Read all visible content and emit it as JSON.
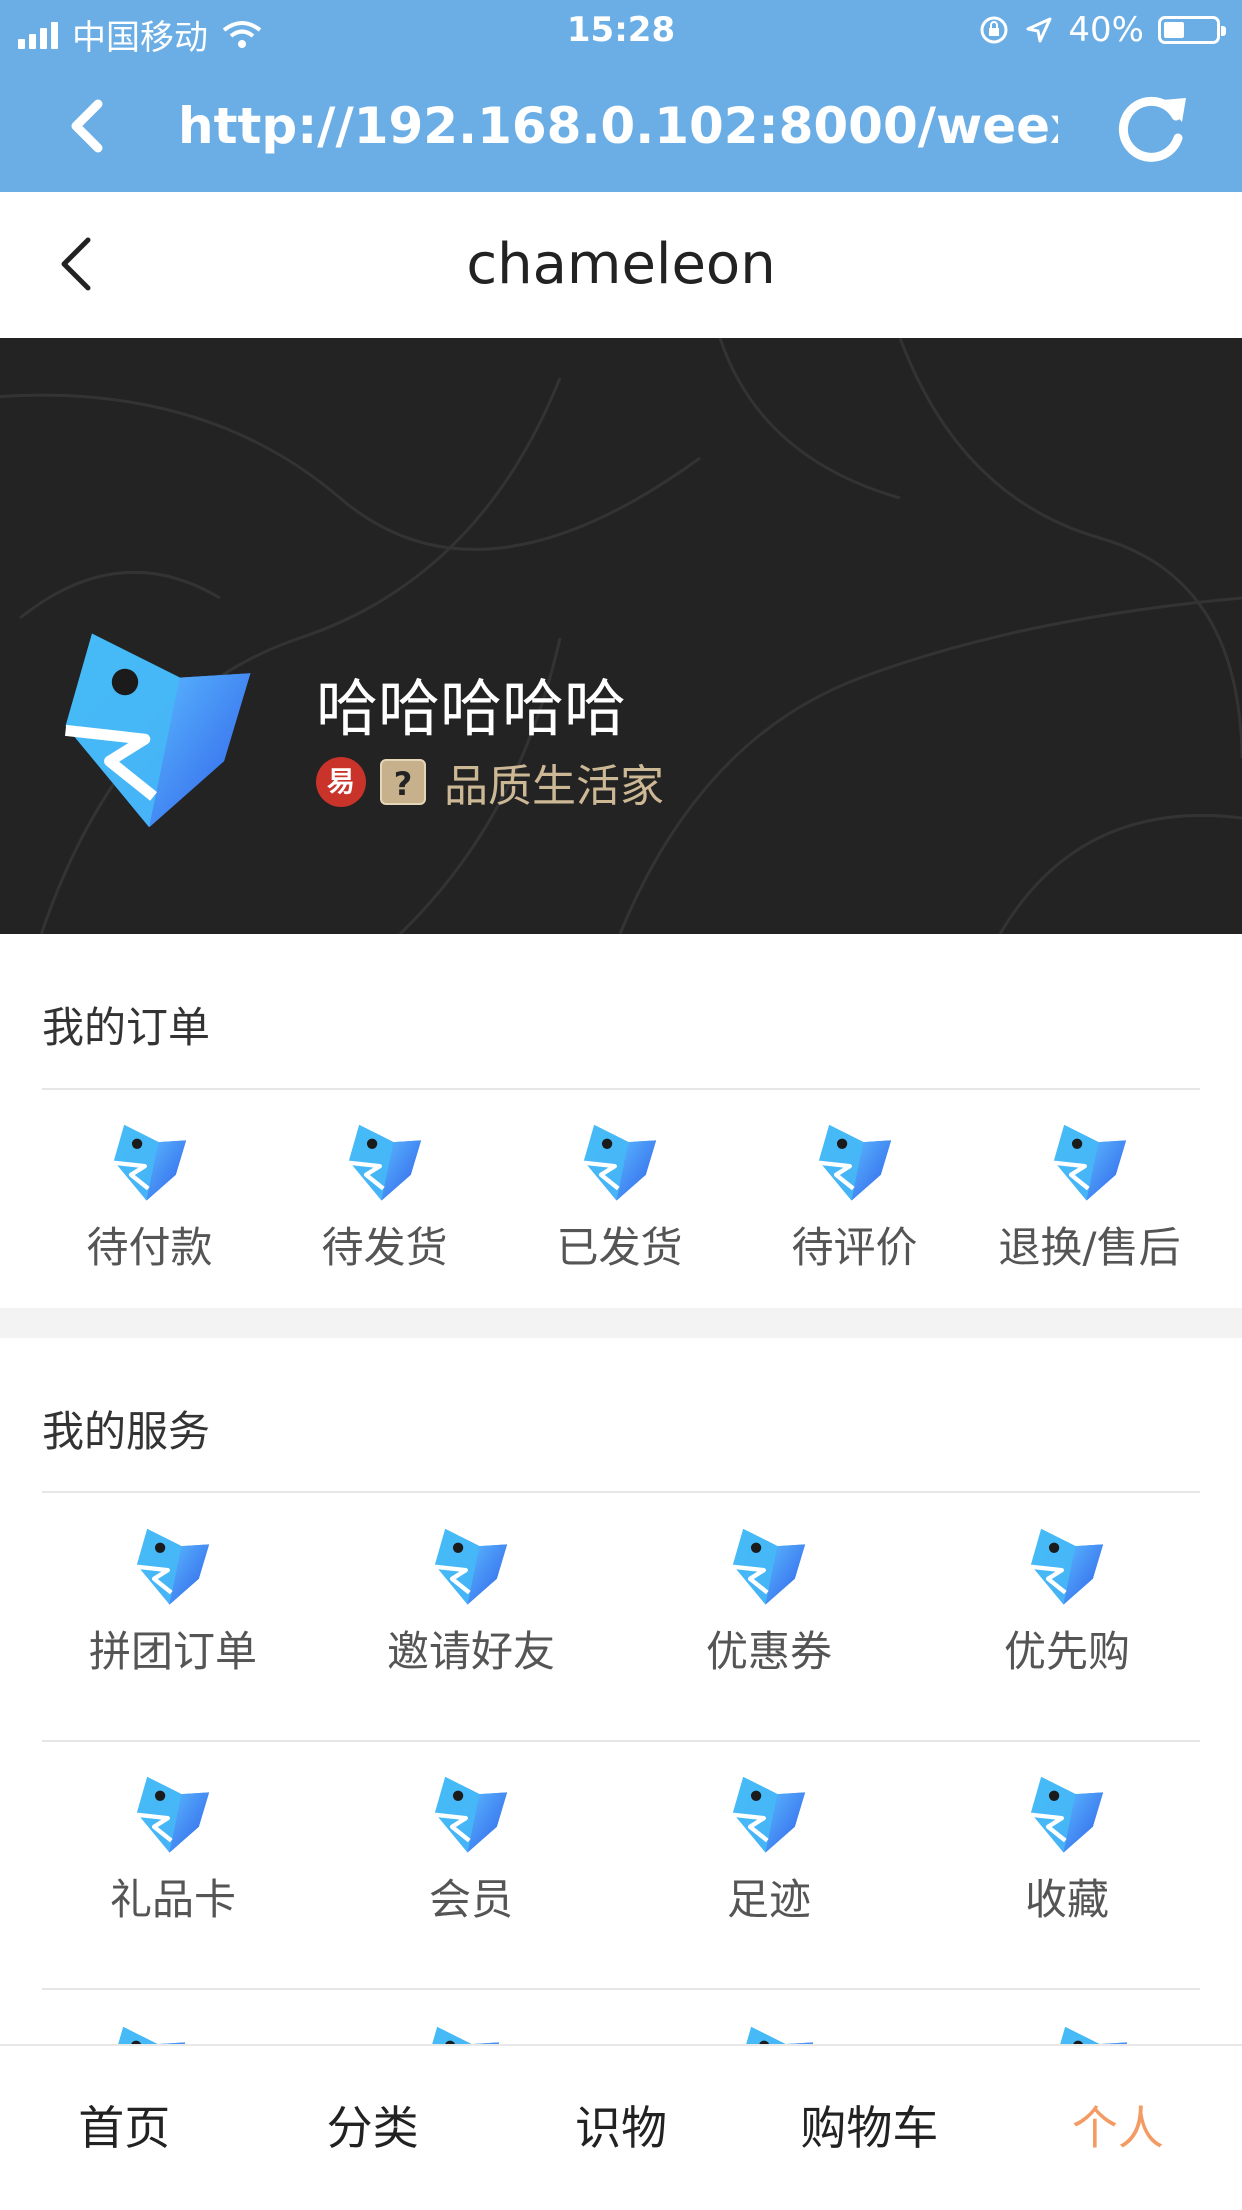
{
  "status_bar": {
    "carrier": "中国移动",
    "time": "15:28",
    "battery": "40%",
    "battery_level": 0.4
  },
  "browser": {
    "url": "http://192.168.0.102:8000/weex/c..."
  },
  "nav": {
    "title": "chameleon"
  },
  "profile": {
    "name": "哈哈哈哈哈",
    "badge_red": "易",
    "badge_gold": "?",
    "level": "品质生活家"
  },
  "orders": {
    "title": "我的订单",
    "items": [
      {
        "label": "待付款"
      },
      {
        "label": "待发货"
      },
      {
        "label": "已发货"
      },
      {
        "label": "待评价"
      },
      {
        "label": "退换/售后"
      }
    ]
  },
  "services": {
    "title": "我的服务",
    "rows": [
      [
        {
          "label": "拼团订单"
        },
        {
          "label": "邀请好友"
        },
        {
          "label": "优惠券"
        },
        {
          "label": "优先购"
        }
      ],
      [
        {
          "label": "礼品卡"
        },
        {
          "label": "会员"
        },
        {
          "label": "足迹"
        },
        {
          "label": "收藏"
        }
      ]
    ]
  },
  "tabbar": {
    "tabs": [
      {
        "label": "首页"
      },
      {
        "label": "分类"
      },
      {
        "label": "识物"
      },
      {
        "label": "购物车"
      },
      {
        "label": "个人"
      }
    ],
    "active_color": "#f39b63"
  },
  "colors": {
    "browser_bar": "#6aaee5",
    "profile_bg": "#232323",
    "level_text": "#cdb896"
  }
}
